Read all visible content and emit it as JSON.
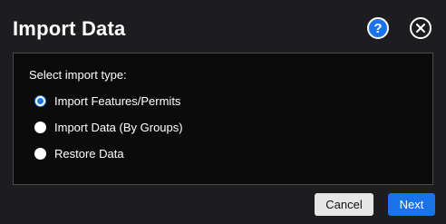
{
  "dialog": {
    "title": "Import Data",
    "help_glyph": "?",
    "help_icon": "help-icon",
    "close_icon": "close-icon"
  },
  "import_type": {
    "label": "Select import type:",
    "options": [
      {
        "label": "Import Features/Permits",
        "selected": true
      },
      {
        "label": "Import Data (By Groups)",
        "selected": false
      },
      {
        "label": "Restore Data",
        "selected": false
      }
    ]
  },
  "footer": {
    "cancel_label": "Cancel",
    "next_label": "Next"
  },
  "colors": {
    "accent": "#1a73e8",
    "background": "#1d1d1f",
    "panel": "#0b0b0c"
  }
}
